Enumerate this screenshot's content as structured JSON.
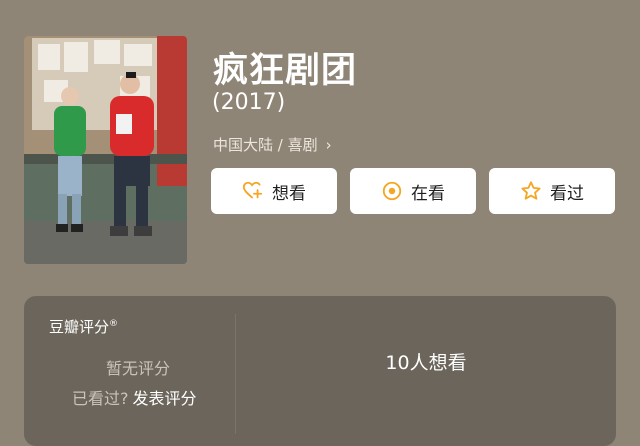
{
  "movie": {
    "title": "疯狂剧团",
    "year": "(2017)",
    "meta": "中国大陆 / 喜剧",
    "meta_chevron": "›"
  },
  "actions": {
    "want_label": "想看",
    "watching_label": "在看",
    "watched_label": "看过"
  },
  "rating": {
    "title": "豆瓣评分",
    "registered_mark": "®",
    "no_rating": "暂无评分",
    "watched_prompt": "已看过?",
    "rate_link": "发表评分",
    "want_count": "10人想看"
  },
  "colors": {
    "background": "#8f8577",
    "card": "#6b655b",
    "accent": "#f5a623"
  },
  "icons": {
    "want": "heart-plus-icon",
    "watching": "circle-dot-icon",
    "watched": "star-icon"
  }
}
